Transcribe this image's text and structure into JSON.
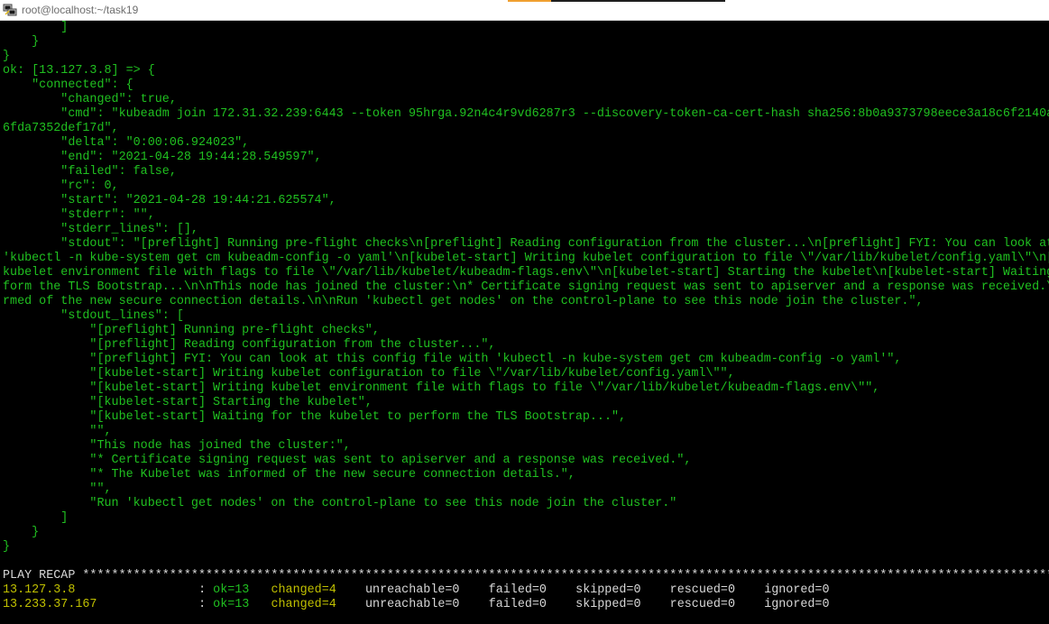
{
  "window": {
    "title": "root@localhost:~/task19",
    "icon": "putty-terminal-icon",
    "accent_color": "#f0a030"
  },
  "colors": {
    "background": "#000000",
    "green": "#20c020",
    "yellow": "#c0c000",
    "white": "#d8d8d8",
    "title_text": "#6e6e6e"
  },
  "terminal": {
    "lines": [
      "        ]",
      "    }",
      "}",
      "ok: [13.127.3.8] => {",
      "    \"connected\": {",
      "        \"changed\": true,",
      "        \"cmd\": \"kubeadm join 172.31.32.239:6443 --token 95hrga.92n4c4r9vd6287r3 --discovery-token-ca-cert-hash sha256:8b0a9373798eece3a18c6f2140a",
      "6fda7352def17d\",",
      "        \"delta\": \"0:00:06.924023\",",
      "        \"end\": \"2021-04-28 19:44:28.549597\",",
      "        \"failed\": false,",
      "        \"rc\": 0,",
      "        \"start\": \"2021-04-28 19:44:21.625574\",",
      "        \"stderr\": \"\",",
      "        \"stderr_lines\": [],",
      "        \"stdout\": \"[preflight] Running pre-flight checks\\n[preflight] Reading configuration from the cluster...\\n[preflight] FYI: You can look at",
      "'kubectl -n kube-system get cm kubeadm-config -o yaml'\\n[kubelet-start] Writing kubelet configuration to file \\\"/var/lib/kubelet/config.yaml\\\"\\n[",
      "kubelet environment file with flags to file \\\"/var/lib/kubelet/kubeadm-flags.env\\\"\\n[kubelet-start] Starting the kubelet\\n[kubelet-start] Waiting",
      "form the TLS Bootstrap...\\n\\nThis node has joined the cluster:\\n* Certificate signing request was sent to apiserver and a response was received.\\",
      "rmed of the new secure connection details.\\n\\nRun 'kubectl get nodes' on the control-plane to see this node join the cluster.\",",
      "        \"stdout_lines\": [",
      "            \"[preflight] Running pre-flight checks\",",
      "            \"[preflight] Reading configuration from the cluster...\",",
      "            \"[preflight] FYI: You can look at this config file with 'kubectl -n kube-system get cm kubeadm-config -o yaml'\",",
      "            \"[kubelet-start] Writing kubelet configuration to file \\\"/var/lib/kubelet/config.yaml\\\"\",",
      "            \"[kubelet-start] Writing kubelet environment file with flags to file \\\"/var/lib/kubelet/kubeadm-flags.env\\\"\",",
      "            \"[kubelet-start] Starting the kubelet\",",
      "            \"[kubelet-start] Waiting for the kubelet to perform the TLS Bootstrap...\",",
      "            \"\",",
      "            \"This node has joined the cluster:\",",
      "            \"* Certificate signing request was sent to apiserver and a response was received.\",",
      "            \"* The Kubelet was informed of the new secure connection details.\",",
      "            \"\",",
      "            \"Run 'kubectl get nodes' on the control-plane to see this node join the cluster.\"",
      "        ]",
      "    }",
      "}",
      ""
    ],
    "recap_header": "PLAY RECAP *******************************************************************************************************************************************",
    "recap": [
      {
        "host": "13.127.3.8",
        "sep": ":",
        "ok": "ok=13",
        "changed": "changed=4",
        "unreachable": "unreachable=0",
        "failed": "failed=0",
        "skipped": "skipped=0",
        "rescued": "rescued=0",
        "ignored": "ignored=0"
      },
      {
        "host": "13.233.37.167",
        "sep": ":",
        "ok": "ok=13",
        "changed": "changed=4",
        "unreachable": "unreachable=0",
        "failed": "failed=0",
        "skipped": "skipped=0",
        "rescued": "rescued=0",
        "ignored": "ignored=0"
      }
    ]
  }
}
